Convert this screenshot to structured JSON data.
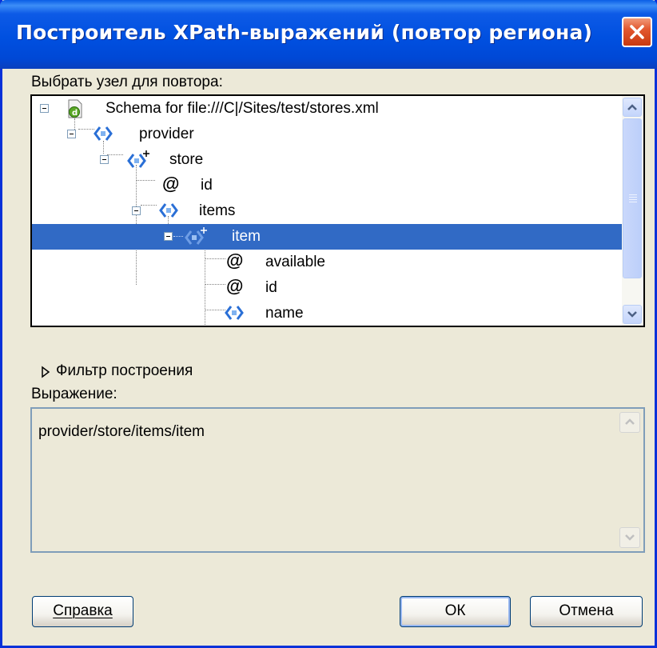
{
  "dialog": {
    "title": "Построитель XPath-выражений (повтор региона)"
  },
  "tree_section": {
    "label": "Выбрать узел для повтора:",
    "nodes": [
      {
        "label": "Schema for file:///C|/Sites/test/stores.xml",
        "icon": "schema-file-icon",
        "expanded": true,
        "selected": false
      },
      {
        "label": "provider",
        "icon": "element-icon",
        "expanded": true,
        "selected": false
      },
      {
        "label": "store",
        "icon": "repeating-element-icon",
        "expanded": true,
        "selected": false
      },
      {
        "label": "id",
        "icon": "attribute-icon",
        "selected": false
      },
      {
        "label": "items",
        "icon": "element-icon",
        "expanded": true,
        "selected": false
      },
      {
        "label": "item",
        "icon": "repeating-element-icon",
        "expanded": true,
        "selected": true
      },
      {
        "label": "available",
        "icon": "attribute-icon",
        "selected": false
      },
      {
        "label": "id",
        "icon": "attribute-icon",
        "selected": false
      },
      {
        "label": "name",
        "icon": "element-icon",
        "selected": false
      }
    ]
  },
  "filter": {
    "label": "Фильтр построения",
    "icon": "triangle-right-icon"
  },
  "expression": {
    "label": "Выражение:",
    "value": "provider/store/items/item"
  },
  "buttons": {
    "help": "Справка",
    "ok": "ОК",
    "cancel": "Отмена"
  },
  "colors": {
    "titlebar": "#0054e3",
    "selection": "#316ac5",
    "dialog_bg": "#ece9d8"
  }
}
